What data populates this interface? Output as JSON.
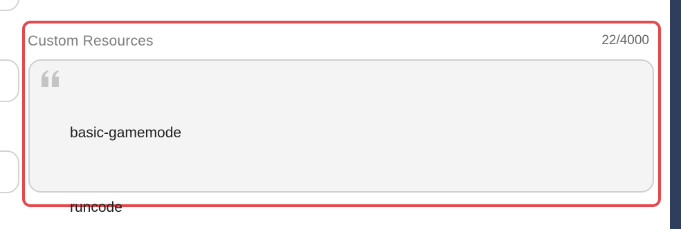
{
  "custom_resources": {
    "label": "Custom Resources",
    "char_count": "22/4000",
    "lines": [
      "basic-gamemode",
      "runcode"
    ]
  },
  "icons": {
    "quote": "quote-icon"
  },
  "colors": {
    "highlight_border": "#e5484d",
    "textarea_bg": "#f4f4f4",
    "right_strip": "#2e3e5c"
  }
}
